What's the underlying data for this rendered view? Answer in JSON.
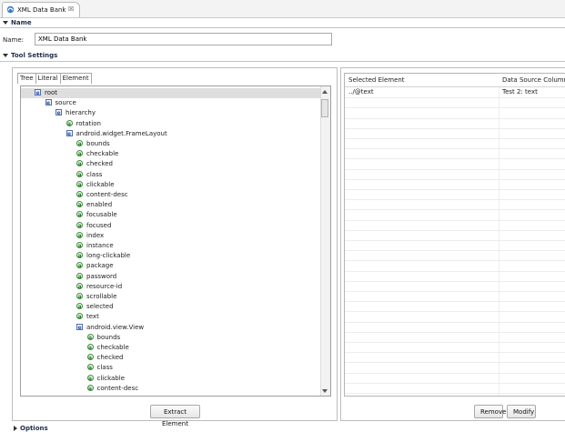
{
  "tab": {
    "title": "XML Data Bank",
    "close": "☒"
  },
  "name_section": {
    "title": "Name",
    "label": "Name:",
    "value": "XML Data Bank"
  },
  "tool_settings": {
    "title": "Tool Settings"
  },
  "tree_tabs": [
    "Tree",
    "Literal",
    "Element"
  ],
  "tree": [
    {
      "label": "root",
      "kind": "e",
      "depth": 0,
      "selected": true
    },
    {
      "label": "source",
      "kind": "e",
      "depth": 1
    },
    {
      "label": "hierarchy",
      "kind": "e",
      "depth": 2
    },
    {
      "label": "rotation",
      "kind": "a",
      "depth": 3
    },
    {
      "label": "android.widget.FrameLayout",
      "kind": "e",
      "depth": 3
    },
    {
      "label": "bounds",
      "kind": "a",
      "depth": 4
    },
    {
      "label": "checkable",
      "kind": "a",
      "depth": 4
    },
    {
      "label": "checked",
      "kind": "a",
      "depth": 4
    },
    {
      "label": "class",
      "kind": "a",
      "depth": 4
    },
    {
      "label": "clickable",
      "kind": "a",
      "depth": 4
    },
    {
      "label": "content-desc",
      "kind": "a",
      "depth": 4
    },
    {
      "label": "enabled",
      "kind": "a",
      "depth": 4
    },
    {
      "label": "focusable",
      "kind": "a",
      "depth": 4
    },
    {
      "label": "focused",
      "kind": "a",
      "depth": 4
    },
    {
      "label": "index",
      "kind": "a",
      "depth": 4
    },
    {
      "label": "instance",
      "kind": "a",
      "depth": 4
    },
    {
      "label": "long-clickable",
      "kind": "a",
      "depth": 4
    },
    {
      "label": "package",
      "kind": "a",
      "depth": 4
    },
    {
      "label": "password",
      "kind": "a",
      "depth": 4
    },
    {
      "label": "resource-id",
      "kind": "a",
      "depth": 4
    },
    {
      "label": "scrollable",
      "kind": "a",
      "depth": 4
    },
    {
      "label": "selected",
      "kind": "a",
      "depth": 4
    },
    {
      "label": "text",
      "kind": "a",
      "depth": 4
    },
    {
      "label": "android.view.View",
      "kind": "e",
      "depth": 4
    },
    {
      "label": "bounds",
      "kind": "a",
      "depth": 5
    },
    {
      "label": "checkable",
      "kind": "a",
      "depth": 5
    },
    {
      "label": "checked",
      "kind": "a",
      "depth": 5
    },
    {
      "label": "class",
      "kind": "a",
      "depth": 5
    },
    {
      "label": "clickable",
      "kind": "a",
      "depth": 5
    },
    {
      "label": "content-desc",
      "kind": "a",
      "depth": 5
    }
  ],
  "buttons": {
    "extract": "Extract Element",
    "remove": "Remove",
    "modify": "Modify"
  },
  "table": {
    "headers": [
      "Selected Element",
      "Data Source Column"
    ],
    "rows": [
      [
        "../@text",
        "Test 2: text"
      ]
    ]
  },
  "options_section": {
    "title": "Options"
  }
}
